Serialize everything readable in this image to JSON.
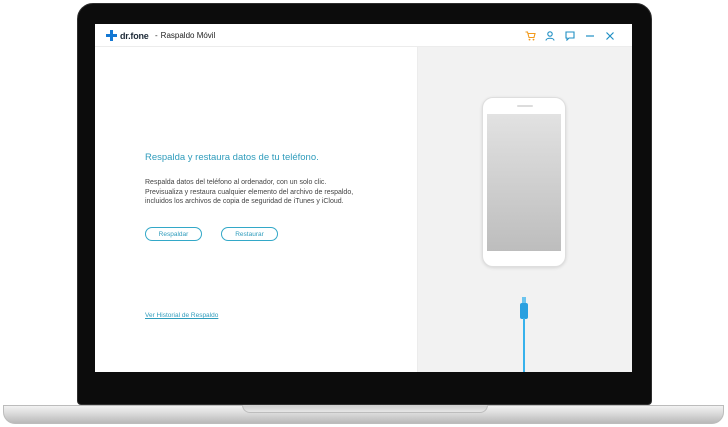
{
  "app": {
    "brand": "dr.fone",
    "separator": "-",
    "subtitle": "Raspaldo Móvil"
  },
  "titlebar": {
    "icons": [
      "cart-icon",
      "user-icon",
      "feedback-icon",
      "minimize-icon",
      "close-icon"
    ],
    "icon_colors": {
      "cart": "#f29a1c",
      "default": "#1f8fc4"
    }
  },
  "main": {
    "headline": "Respalda y restaura datos de tu teléfono.",
    "description": [
      "Respalda datos del teléfono al ordenador, con un solo clic.",
      "Previsualiza y restaura cualquier elemento del archivo de respaldo,",
      "incluidos los archivos de copia de seguridad de iTunes y iCloud."
    ],
    "backup_label": "Respaldar",
    "restore_label": "Restaurar",
    "history_link": "Ver Historial de Respaldo"
  },
  "colors": {
    "accent": "#2f9cbc",
    "logo_blue": "#1478d3",
    "cable_blue": "#38b2ec"
  }
}
